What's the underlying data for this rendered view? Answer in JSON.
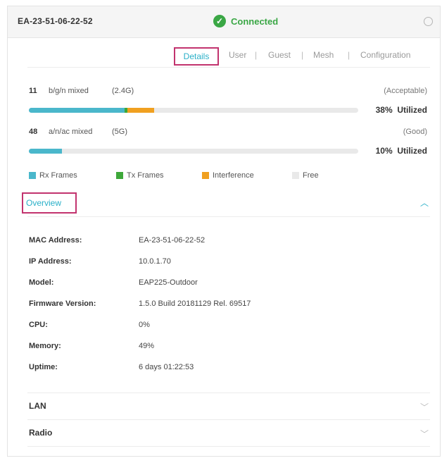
{
  "header": {
    "device_name": "EA-23-51-06-22-52",
    "status": "Connected",
    "status_color": "#3aa745"
  },
  "tabs": [
    "Details",
    "User",
    "Guest",
    "Mesh",
    "Configuration"
  ],
  "radios": [
    {
      "channel": "11",
      "mode": "b/g/n mixed",
      "band": "(2.4G)",
      "quality": "(Acceptable)",
      "utilization_pct": "38%",
      "utilized_label": "Utilized",
      "rx_pct": 29,
      "tx_pct": 1,
      "interference_pct": 8
    },
    {
      "channel": "48",
      "mode": "a/n/ac mixed",
      "band": "(5G)",
      "quality": "(Good)",
      "utilization_pct": "10%",
      "utilized_label": "Utilized",
      "rx_pct": 10,
      "tx_pct": 0,
      "interference_pct": 0
    }
  ],
  "legend": [
    {
      "label": "Rx Frames",
      "color": "#4ab7cb"
    },
    {
      "label": "Tx Frames",
      "color": "#3ea83a"
    },
    {
      "label": "Interference",
      "color": "#f0a020"
    },
    {
      "label": "Free",
      "color": "#e9e9e9"
    }
  ],
  "overview": {
    "title": "Overview",
    "fields": [
      {
        "label": "MAC Address:",
        "value": "EA-23-51-06-22-52"
      },
      {
        "label": "IP Address:",
        "value": "10.0.1.70"
      },
      {
        "label": "Model:",
        "value": "EAP225-Outdoor"
      },
      {
        "label": "Firmware Version:",
        "value": "1.5.0 Build 20181129 Rel. 69517"
      },
      {
        "label": "CPU:",
        "value": "0%"
      },
      {
        "label": "Memory:",
        "value": "49%"
      },
      {
        "label": "Uptime:",
        "value": "6 days 01:22:53"
      }
    ]
  },
  "sections": {
    "lan": "LAN",
    "radio": "Radio"
  },
  "icons": {
    "status": "check-circle-icon",
    "close": "close-icon",
    "expand": "chevron-up-icon",
    "collapse": "chevron-down-icon"
  }
}
